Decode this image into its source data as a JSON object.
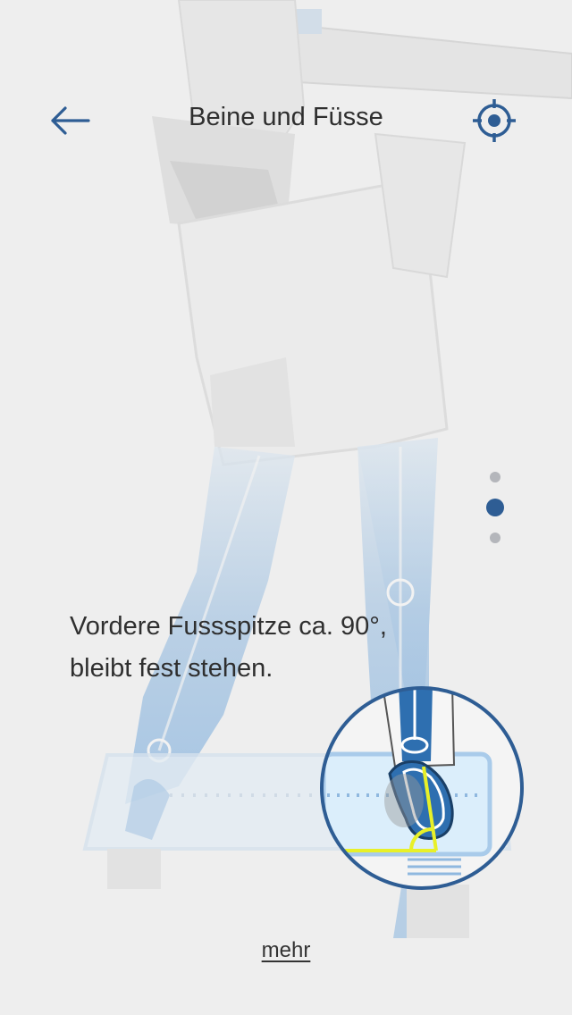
{
  "header": {
    "title": "Beine und Füsse",
    "back_icon": "arrow-left-icon",
    "action_icon": "crosshair-target-icon"
  },
  "pager": {
    "count": 3,
    "active_index": 1
  },
  "instruction": {
    "line1": "Vordere Fussspitze ca. 90°,",
    "line2": "bleibt fest stehen."
  },
  "more_link": "mehr",
  "colors": {
    "background": "#eeeeee",
    "accent": "#2e5d94",
    "highlight": "#e8f028",
    "text": "#2f2f2f",
    "inactive_dot": "#b4b6bb"
  }
}
